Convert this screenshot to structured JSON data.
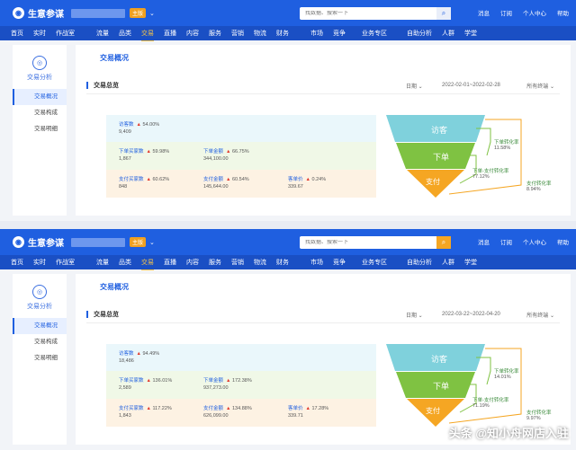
{
  "app": {
    "title": "生意参谋",
    "badge": "主版",
    "search_placeholder": "找数据、搜索一下",
    "top_links": [
      "消息",
      "订阅",
      "个人中心",
      "帮助"
    ]
  },
  "nav": [
    "首页",
    "实时",
    "作战室",
    "流量",
    "品类",
    "交易",
    "直播",
    "内容",
    "服务",
    "营销",
    "物流",
    "财务",
    "市场",
    "竞争",
    "业务专区",
    "自助分析",
    "人群",
    "学堂"
  ],
  "nav_active": "交易",
  "sidebar": {
    "title": "交易分析",
    "items": [
      "交易概况",
      "交易构成",
      "交易明细"
    ]
  },
  "page_title": "交易概况",
  "section_title": "交易总览",
  "date_label": "日期",
  "terminal_label": "所有终端",
  "funnel_labels": {
    "visitors": "访客",
    "order": "下单",
    "pay": "支付",
    "order_rate_label": "下单转化率",
    "order_pay_rate_label": "下单-支付转化率",
    "pay_rate_label": "支付转化率"
  },
  "shot1": {
    "date_range": "2022-02-01~2022-02-28",
    "metrics": {
      "visitors": {
        "label": "访客数",
        "pct": "54.00%",
        "value": "9,409"
      },
      "order_buyers": {
        "label": "下单买家数",
        "pct": "59.98%",
        "value": "1,867"
      },
      "order_amount": {
        "label": "下单金额",
        "pct": "66.75%",
        "value": "344,100.00"
      },
      "pay_buyers": {
        "label": "支付买家数",
        "pct": "60.62%",
        "value": "848"
      },
      "pay_amount": {
        "label": "支付金额",
        "pct": "60.54%",
        "value": "145,644.00"
      },
      "unit_price": {
        "label": "客单价",
        "pct": "0.24%",
        "value": "339.67"
      }
    },
    "rates": {
      "order_rate": "11.58%",
      "order_pay_rate": "77.12%",
      "pay_rate": "8.94%"
    }
  },
  "shot2": {
    "date_range": "2022-03-22~2022-04-20",
    "metrics": {
      "visitors": {
        "label": "访客数",
        "pct": "94.49%",
        "value": "18,486"
      },
      "order_buyers": {
        "label": "下单买家数",
        "pct": "136.01%",
        "value": "2,589"
      },
      "order_amount": {
        "label": "下单金额",
        "pct": "172.38%",
        "value": "937,273.00"
      },
      "pay_buyers": {
        "label": "支付买家数",
        "pct": "117.22%",
        "value": "1,843"
      },
      "pay_amount": {
        "label": "支付金额",
        "pct": "134.88%",
        "value": "626,099.00"
      },
      "unit_price": {
        "label": "客单价",
        "pct": "17.28%",
        "value": "339.71"
      }
    },
    "rates": {
      "order_rate": "14.01%",
      "order_pay_rate": "71.19%",
      "pay_rate": "9.97%"
    }
  },
  "watermark": {
    "corner": "头条 @知小舟网店入驻"
  },
  "colors": {
    "header": "#1f5fe0",
    "nav": "#1a4fc4",
    "active": "#f5c54a",
    "funnel_top": "#7fd1dc",
    "funnel_mid": "#7fc242",
    "funnel_bottom": "#f5a623"
  }
}
